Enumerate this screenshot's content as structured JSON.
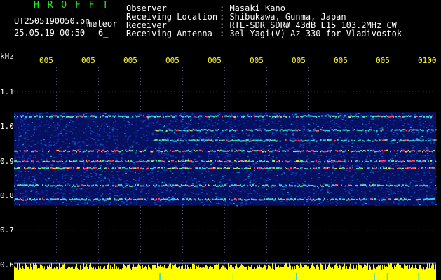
{
  "header": {
    "brand": "H R O F F T",
    "filename": "UT2505190050.pn",
    "category": "meteor",
    "datetime": "25.05.19 00:50",
    "extra": "6_",
    "fields": [
      {
        "label": "Observer",
        "value": ": Masaki Kano"
      },
      {
        "label": "Receiving Location",
        "value": ": Shibukawa, Gunma, Japan"
      },
      {
        "label": "Receiver",
        "value": ": RTL-SDR SDR# 43dB L15 103.2MHz CW"
      },
      {
        "label": "Receiving Antenna",
        "value": ": 3el Yagi(V) Az 330 for Vladivostok"
      }
    ]
  },
  "axis": {
    "y_unit": "kHz",
    "y_ticks": [
      "1.1",
      "1.0",
      "0.9",
      "0.8",
      "0.7",
      "0.6"
    ],
    "x_ticks": [
      "005",
      "005",
      "005",
      "005",
      "005",
      "005",
      "005",
      "005",
      "005",
      "0100"
    ]
  },
  "colors": {
    "background": "#000000",
    "text": "#ffffff",
    "title": "#22ee22",
    "tick_labels": "#ffff22",
    "noise_floor": "#0a1a8a",
    "signal_strong": "#ff3333",
    "power_bar": "#ffff00"
  },
  "spectrogram": {
    "traces_khz": [
      0.79,
      0.83,
      0.88,
      0.9,
      0.93,
      0.96,
      0.99,
      1.03
    ],
    "change_minute_fraction": 0.33
  }
}
